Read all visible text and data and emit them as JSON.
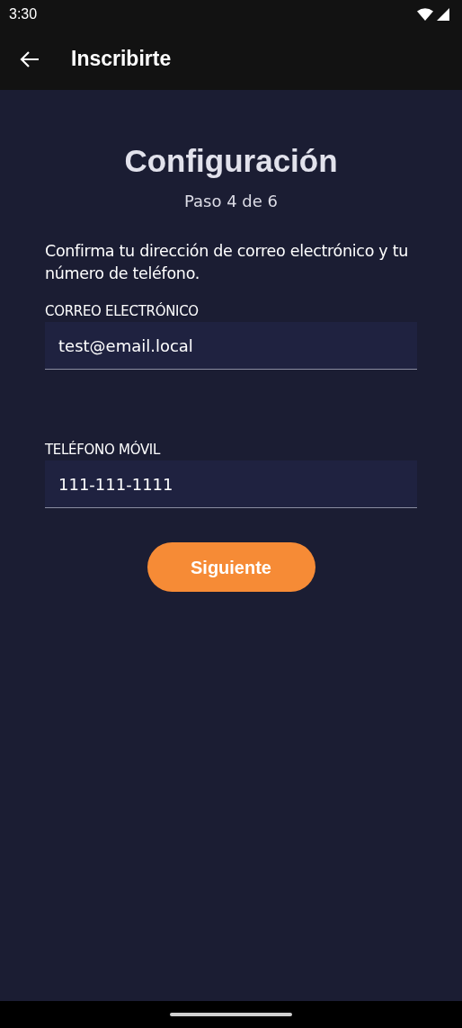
{
  "status_bar": {
    "time": "3:30"
  },
  "app_bar": {
    "title": "Inscribirte"
  },
  "heading": "Configuración",
  "step": "Paso 4 de 6",
  "instructions": "Confirma tu dirección de correo electrónico y tu número de teléfono.",
  "fields": [
    {
      "label": "CORREO ELECTRÓNICO",
      "value": "test@email.local"
    },
    {
      "label": "TELÉFONO MÓVIL",
      "value": "111-111-1111"
    }
  ],
  "buttons": [
    "Siguiente"
  ]
}
